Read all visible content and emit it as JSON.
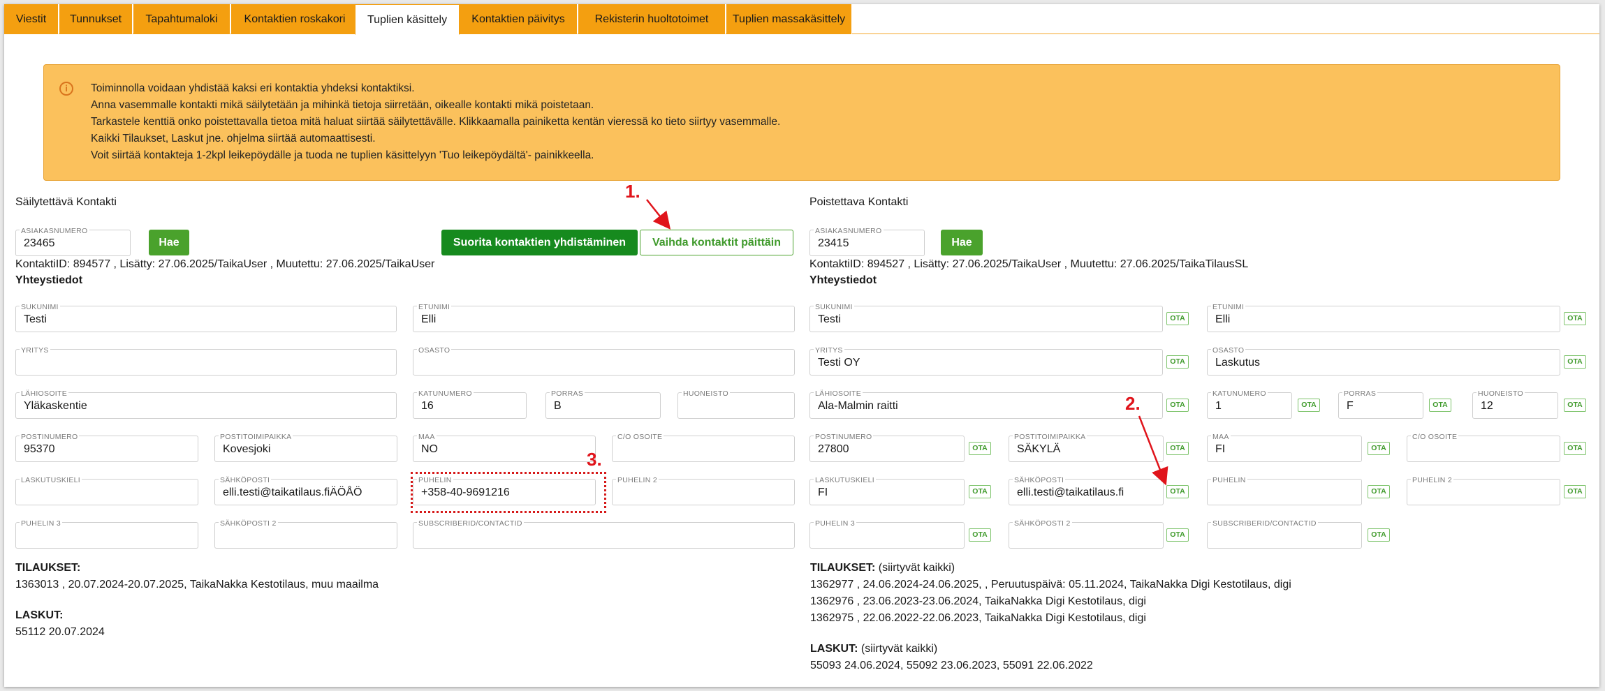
{
  "tabs": [
    "Viestit",
    "Tunnukset",
    "Tapahtumaloki",
    "Kontaktien roskakori",
    "Tuplien käsittely",
    "Kontaktien päivitys",
    "Rekisterin huoltotoimet",
    "Tuplien massakäsittely"
  ],
  "info": {
    "icon": "info-icon",
    "lines": [
      "Toiminnolla voidaan yhdistää kaksi eri kontaktia yhdeksi kontaktiksi.",
      "Anna vasemmalle kontakti mikä säilytetään ja mihinkä tietoja siirretään, oikealle kontakti mikä poistetaan.",
      "Tarkastele kenttiä onko poistettavalla tietoa mitä haluat siirtää säilytettävälle. Klikkaamalla painiketta kentän vieressä ko tieto siirtyy vasemmalle.",
      "Kaikki Tilaukset, Laskut jne. ohjelma siirtää automaattisesti.",
      "Voit siirtää kontakteja 1-2kpl leikepöydälle ja tuoda ne tuplien käsittelyyn 'Tuo leikepöydältä'- painikkeella."
    ]
  },
  "actions": {
    "merge": "Suorita kontaktien yhdistäminen",
    "swap": "Vaihda kontaktit päittäin"
  },
  "annotations": {
    "a1": "1.",
    "a2": "2.",
    "a3": "3."
  },
  "left": {
    "title": "Säilytettävä Kontakti",
    "customer_label": "ASIAKASNUMERO",
    "customer_no": "23465",
    "search_button": "Hae",
    "meta": "KontaktiID: 894577 , Lisätty: 27.06.2025/TaikaUser , Muutettu: 27.06.2025/TaikaUser",
    "section": "Yhteystiedot",
    "labels": {
      "sukunimi": "SUKUNIMI",
      "etunimi": "ETUNIMI",
      "yritys": "YRITYS",
      "osasto": "OSASTO",
      "lahiosoite": "LÄHIOSOITE",
      "katunumero": "KATUNUMERO",
      "porras": "PORRAS",
      "huoneisto": "HUONEISTO",
      "postinumero": "POSTINUMERO",
      "postitoimipaikka": "POSTITOIMIPAIKKA",
      "maa": "MAA",
      "co": "C/O OSOITE",
      "laskutuskieli": "LASKUTUSKIELI",
      "sahkoposti": "SÄHKÖPOSTI",
      "puhelin": "PUHELIN",
      "puhelin2": "PUHELIN 2",
      "puhelin3": "PUHELIN 3",
      "sahkoposti2": "SÄHKÖPOSTI 2",
      "subscriber": "SUBSCRIBERID/CONTACTID"
    },
    "values": {
      "sukunimi": "Testi",
      "etunimi": "Elli",
      "yritys": "",
      "osasto": "",
      "lahiosoite": "Yläkaskentie",
      "katunumero": "16",
      "porras": "B",
      "huoneisto": "",
      "postinumero": "95370",
      "postitoimipaikka": "Kovesjoki",
      "maa": "NO",
      "co": "",
      "laskutuskieli": "",
      "sahkoposti": "elli.testi@taikatilaus.fiÄÖÅÖ",
      "puhelin": "+358-40-9691216",
      "puhelin2": "",
      "puhelin3": "",
      "sahkoposti2": "",
      "subscriber": ""
    },
    "orders_title": "TILAUKSET:",
    "orders": [
      "1363013 , 20.07.2024-20.07.2025, TaikaNakka Kestotilaus, muu maailma"
    ],
    "invoices_title": "LASKUT:",
    "invoices": "55112 20.07.2024"
  },
  "right": {
    "title": "Poistettava Kontakti",
    "customer_label": "ASIAKASNUMERO",
    "customer_no": "23415",
    "search_button": "Hae",
    "meta": "KontaktiID: 894527 , Lisätty: 27.06.2025/TaikaUser , Muutettu: 27.06.2025/TaikaTilausSL",
    "section": "Yhteystiedot",
    "ota": "OTA",
    "values": {
      "sukunimi": "Testi",
      "etunimi": "Elli",
      "yritys": "Testi OY",
      "osasto": "Laskutus",
      "lahiosoite": "Ala-Malmin raitti",
      "katunumero": "1",
      "porras": "F",
      "huoneisto": "12",
      "postinumero": "27800",
      "postitoimipaikka": "SÄKYLÄ",
      "maa": "FI",
      "co": "",
      "laskutuskieli": "FI",
      "sahkoposti": "elli.testi@taikatilaus.fi",
      "puhelin": "",
      "puhelin2": "",
      "puhelin3": "",
      "sahkoposti2": "",
      "subscriber": ""
    },
    "orders_title": "TILAUKSET:",
    "orders_note": "(siirtyvät kaikki)",
    "orders": [
      "1362977 , 24.06.2024-24.06.2025, , Peruutuspäivä: 05.11.2024, TaikaNakka Digi Kestotilaus, digi",
      "1362976 , 23.06.2023-23.06.2024, TaikaNakka Digi Kestotilaus, digi",
      "1362975 , 22.06.2022-22.06.2023, TaikaNakka Digi Kestotilaus, digi"
    ],
    "invoices_title": "LASKUT:",
    "invoices_note": "(siirtyvät kaikki)",
    "invoices": "55093 24.06.2024, 55092 23.06.2023, 55091 22.06.2022"
  }
}
